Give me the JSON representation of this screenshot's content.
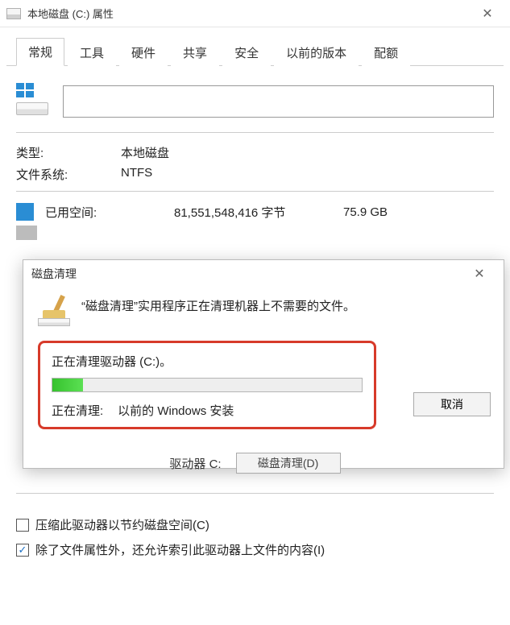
{
  "window": {
    "title": "本地磁盘 (C:) 属性"
  },
  "tabs": [
    "常规",
    "工具",
    "硬件",
    "共享",
    "安全",
    "以前的版本",
    "配额"
  ],
  "general": {
    "name_value": "",
    "type_label": "类型:",
    "type_value": "本地磁盘",
    "fs_label": "文件系统:",
    "fs_value": "NTFS",
    "used_label": "已用空间:",
    "used_bytes": "81,551,548,416 字节",
    "used_gb": "75.9 GB",
    "drive_line": "驱动器 C:",
    "disk_cleanup_btn": "磁盘清理(D)",
    "compress_cb": "压缩此驱动器以节约磁盘空间(C)",
    "index_cb": "除了文件属性外，还允许索引此驱动器上文件的内容(I)"
  },
  "cleanup": {
    "title": "磁盘清理",
    "message": "“磁盘清理”实用程序正在清理机器上不需要的文件。",
    "line1": "正在清理驱动器  (C:)。",
    "line2_label": "正在清理:",
    "line2_value": "以前的 Windows 安装",
    "cancel": "取消",
    "progress_percent": 10
  }
}
